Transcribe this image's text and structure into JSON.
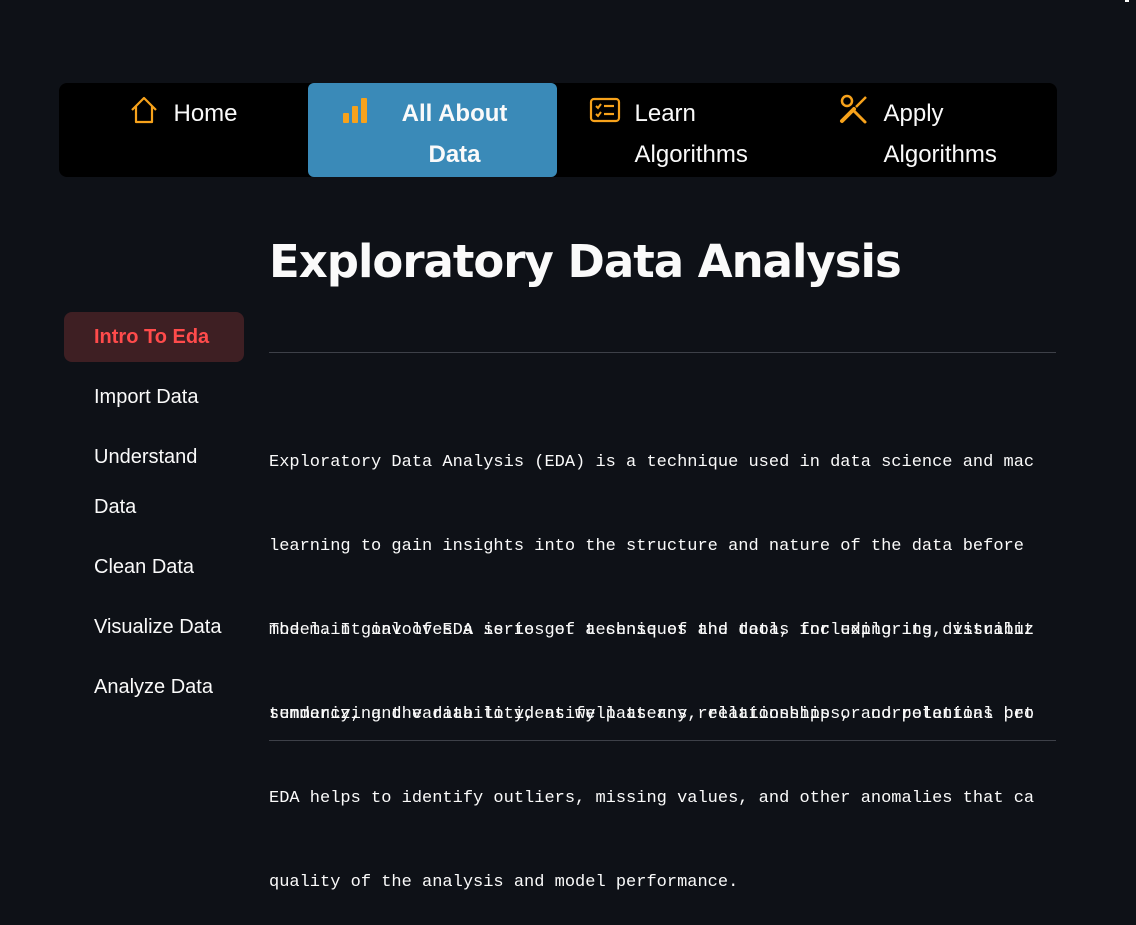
{
  "nav": {
    "items": [
      {
        "label": "Home",
        "icon": "house-icon",
        "icon_color": "#f7a21b",
        "active": false
      },
      {
        "label": "All About Data",
        "icon": "bar-chart-icon",
        "icon_color": "#f7a21b",
        "active": true
      },
      {
        "label": "Learn Algorithms",
        "icon": "list-card-icon",
        "icon_color": "#f7a21b",
        "active": false
      },
      {
        "label": "Apply Algorithms",
        "icon": "tools-icon",
        "icon_color": "#f7a21b",
        "active": false
      }
    ],
    "active_color": "#3a8ab8"
  },
  "sidebar": {
    "items": [
      {
        "label": "Intro To Eda",
        "active": true
      },
      {
        "label": "Import Data"
      },
      {
        "label": "Understand Data"
      },
      {
        "label": "Clean Data"
      },
      {
        "label": "Visualize Data"
      },
      {
        "label": "Analyze Data"
      }
    ],
    "active_color": "#ff4b4b"
  },
  "main": {
    "title": "Exploratory Data Analysis",
    "paragraph1": [
      "Exploratory Data Analysis (EDA) is a technique used in data science and mac",
      "learning to gain insights into the structure and nature of the data before",
      "model. It involves a series of techniques and tools for exploring, visualiz",
      "summarizing the data to identify patterns, relationships, and potential pro"
    ],
    "paragraph2": [
      "The main goal of EDA is to get a sense of the data, including its distribut",
      "tendency, and variability, as well as any relationships or correlations bet",
      "EDA helps to identify outliers, missing values, and other anomalies that ca",
      "quality of the analysis and model performance."
    ]
  }
}
